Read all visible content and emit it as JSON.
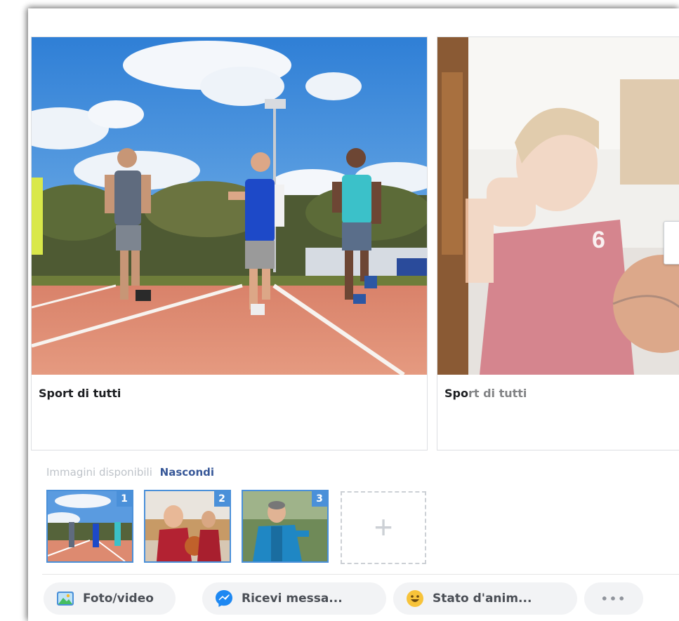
{
  "cards": [
    {
      "caption": "Sport di tutti"
    },
    {
      "caption": "Sport di tutti"
    }
  ],
  "available_label": "Immagini disponibili",
  "hide_link": "Nascondi",
  "thumbnails": [
    {
      "number": "1"
    },
    {
      "number": "2"
    },
    {
      "number": "3"
    }
  ],
  "add_symbol": "+",
  "actions": {
    "photo_video": "Foto/video",
    "messages": "Ricevi messa...",
    "feeling": "Stato d'anim...",
    "more": "•••"
  },
  "colors": {
    "link": "#385898",
    "thumb_border": "#4a90d9",
    "pill_bg": "#f2f3f5"
  }
}
